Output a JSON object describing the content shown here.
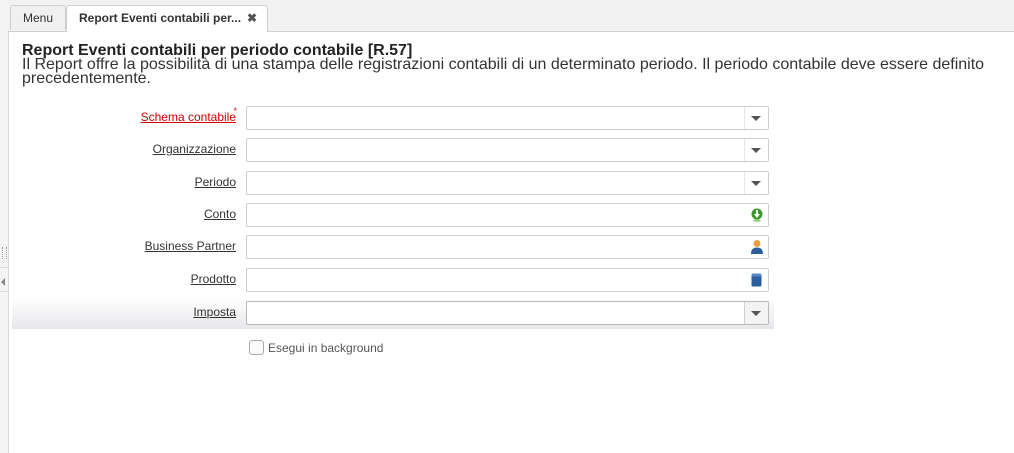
{
  "tabs": {
    "menu_label": "Menu",
    "active_label": "Report Eventi contabili per...",
    "close_glyph": "✖"
  },
  "report": {
    "title": "Report Eventi contabili per periodo contabile [R.57]",
    "description": "Il Report offre la possibilità di una stampa delle registrazioni contabili di un determinato periodo. Il periodo contabile deve essere definito precedentemente."
  },
  "fields": {
    "schema": {
      "label": "Schema contabile",
      "required_mark": "*",
      "value": ""
    },
    "organizzazione": {
      "label": "Organizzazione",
      "value": ""
    },
    "periodo": {
      "label": "Periodo",
      "value": ""
    },
    "conto": {
      "label": "Conto",
      "value": "",
      "icon": "account-lookup-icon"
    },
    "business_partner": {
      "label": "Business Partner",
      "value": "",
      "icon": "business-partner-icon"
    },
    "prodotto": {
      "label": "Prodotto",
      "value": "",
      "icon": "product-icon"
    },
    "imposta": {
      "label": "Imposta",
      "value": ""
    }
  },
  "background_option": {
    "label": "Esegui in background",
    "checked": false
  },
  "colors": {
    "required": "#cc0000",
    "accent_green": "#3a9a2c",
    "accent_blue": "#2c5e9e"
  }
}
